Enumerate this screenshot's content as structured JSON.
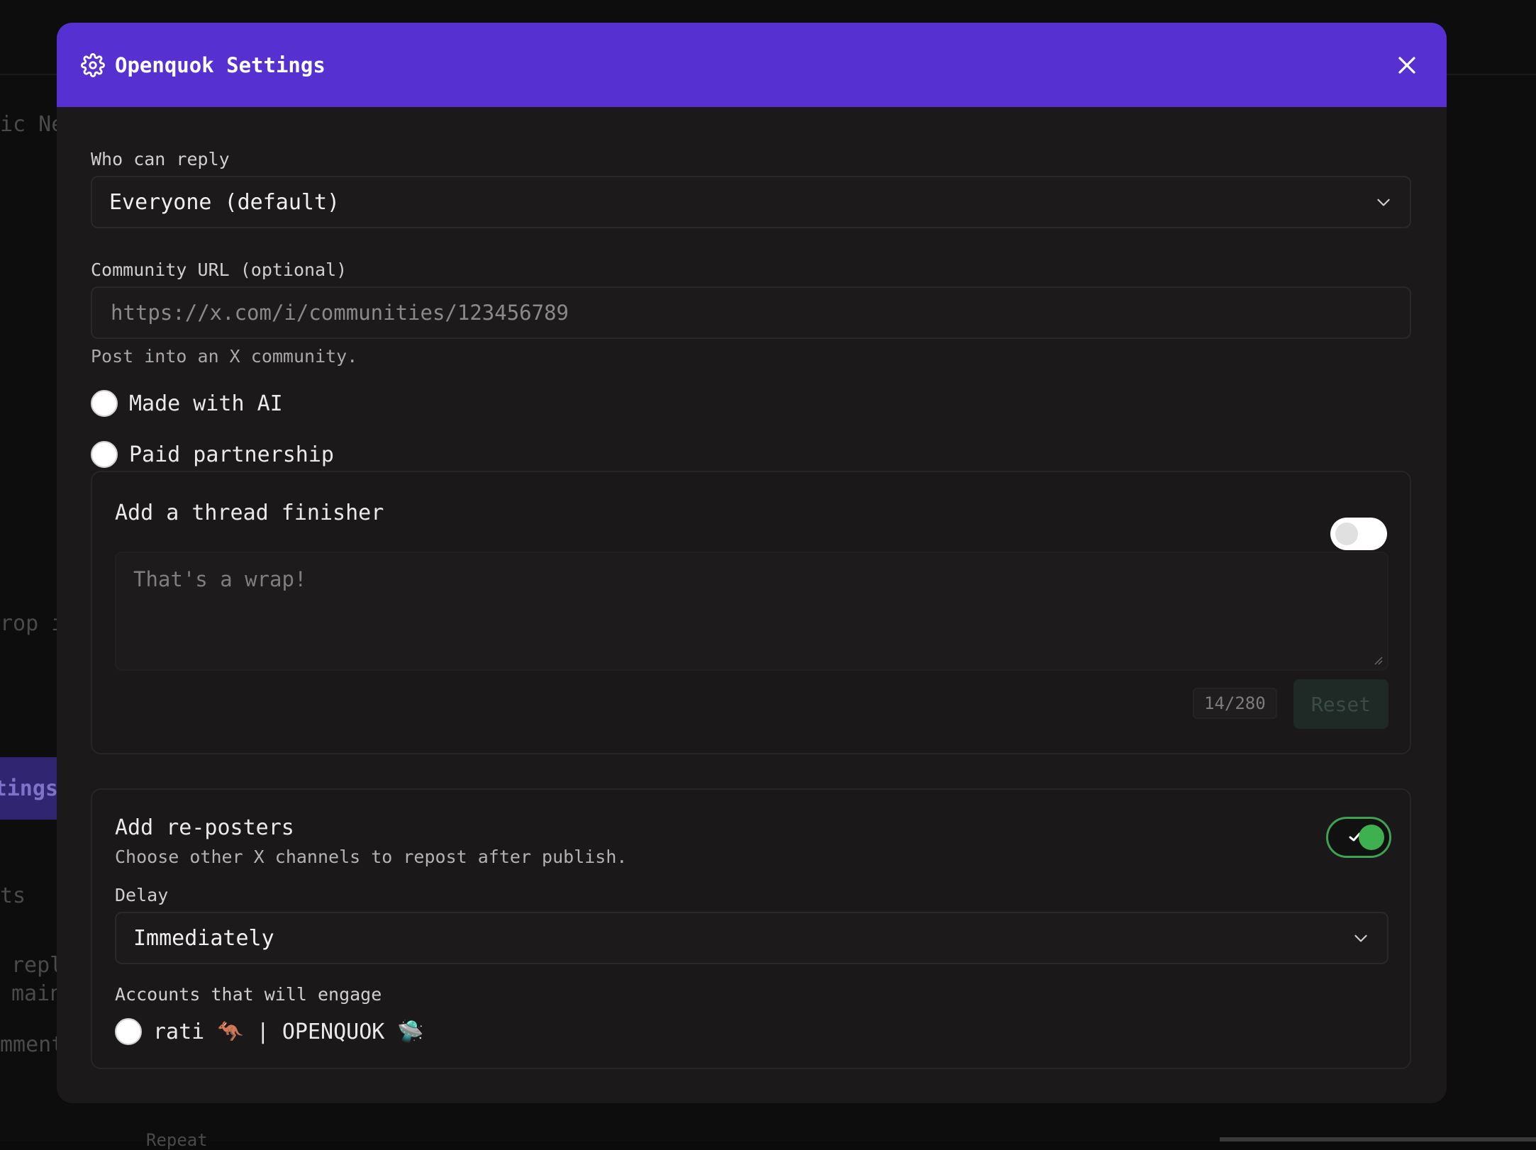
{
  "background": {
    "fragment_1": "ic Net",
    "fragment_2": "rop i",
    "tab_fragment": "tings",
    "fragment_3": "ts",
    "fragment_4": "repl",
    "fragment_5": "main",
    "fragment_6": "mment",
    "fragment_7": "Repeat"
  },
  "modal": {
    "title": "Openquok Settings",
    "accent_color": "#5630d1",
    "who_can_reply": {
      "label": "Who can reply",
      "value": "Everyone (default)"
    },
    "community_url": {
      "label": "Community URL (optional)",
      "placeholder": "https://x.com/i/communities/123456789",
      "helper": "Post into an X community."
    },
    "checkboxes": [
      {
        "label": "Made with AI",
        "checked": false
      },
      {
        "label": "Paid partnership",
        "checked": false
      }
    ],
    "thread_finisher": {
      "title": "Add a thread finisher",
      "enabled": false,
      "placeholder": "That's a wrap!",
      "counter": "14/280",
      "reset_label": "Reset"
    },
    "reposters": {
      "title": "Add re-posters",
      "description": "Choose other X channels to repost after publish.",
      "enabled": true,
      "delay_label": "Delay",
      "delay_value": "Immediately",
      "accounts_label": "Accounts that will engage",
      "accounts": [
        {
          "name": "rati 🦘 | OPENQUOK 🛸",
          "checked": false
        }
      ]
    }
  }
}
